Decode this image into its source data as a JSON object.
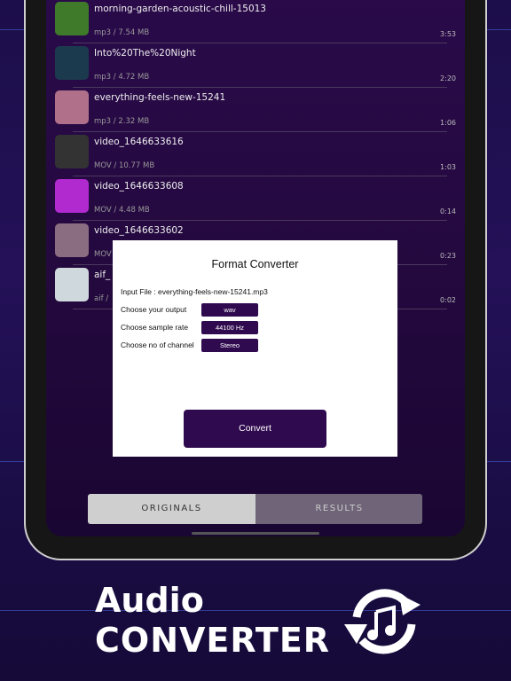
{
  "files": [
    {
      "title": "morning-garden-acoustic-chill-15013",
      "meta": "mp3 / 7.54 MB",
      "duration": "3:53",
      "thumb": "#3f7a2a"
    },
    {
      "title": "Into%20The%20Night",
      "meta": "mp3 / 4.72 MB",
      "duration": "2:20",
      "thumb": "#1c3a4e"
    },
    {
      "title": "everything-feels-new-15241",
      "meta": "mp3 / 2.32 MB",
      "duration": "1:06",
      "thumb": "#b0708a"
    },
    {
      "title": "video_1646633616",
      "meta": "MOV / 10.77 MB",
      "duration": "1:03",
      "thumb": "#333333"
    },
    {
      "title": "video_1646633608",
      "meta": "MOV / 4.48 MB",
      "duration": "0:14",
      "thumb": "#b02ad0"
    },
    {
      "title": "video_1646633602",
      "meta": "MOV",
      "duration": "0:23",
      "thumb": "#8a6d80"
    },
    {
      "title": "aif_",
      "meta": "aif /",
      "duration": "0:02",
      "thumb": "#cfd8dc"
    }
  ],
  "dialog": {
    "title": "Format Converter",
    "input_file": "Input File : everything-feels-new-15241.mp3",
    "output_label": "Choose your output",
    "output_value": "wav",
    "rate_label": "Choose sample rate",
    "rate_value": "44100 Hz",
    "channel_label": "Choose no of channel",
    "channel_value": "Stereo",
    "convert_label": "Convert"
  },
  "tabs": {
    "originals": "ORIGINALS",
    "results": "RESULTS",
    "active": "originals"
  },
  "headline": {
    "line1": "Audio",
    "line2": "CONVERTER"
  },
  "colors": {
    "accent": "#2f0a4f"
  }
}
